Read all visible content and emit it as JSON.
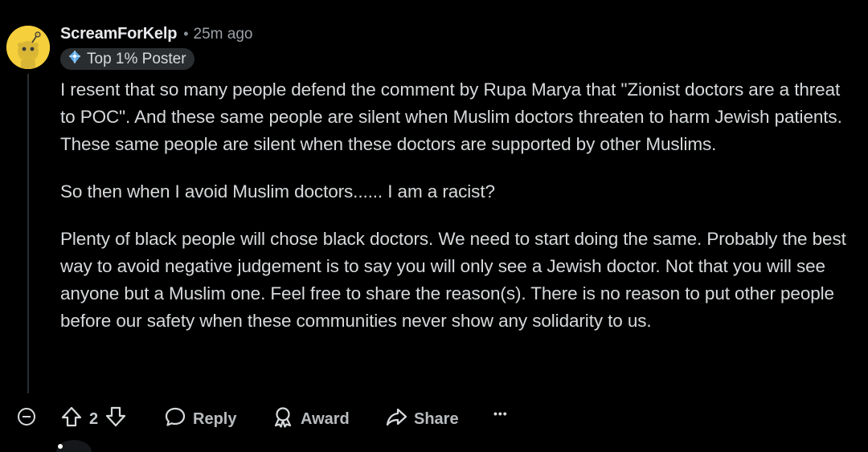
{
  "comment": {
    "author": "ScreamForKelp",
    "separator": "•",
    "time": "25m ago",
    "flair": "Top 1% Poster",
    "avatar_color": "#f5cf3c",
    "paragraphs": [
      "I resent that so many people defend the comment by Rupa Marya that \"Zionist doctors are a threat to POC\". And these same people are silent when Muslim doctors threaten to harm Jewish patients. These same people are silent when these doctors are supported by other Muslims.",
      "So then when I avoid Muslim doctors...... I am a racist?",
      "Plenty of black people will chose black doctors. We need to start doing the same. Probably the best way to avoid negative judgement is to say you will only see a Jewish doctor. Not that you will see anyone but a Muslim one. Feel free to share the reason(s). There is no reason to put other people before our safety when these communities never show any solidarity to us."
    ]
  },
  "actions": {
    "vote_count": "2",
    "reply_label": "Reply",
    "award_label": "Award",
    "share_label": "Share",
    "more_label": "•••"
  },
  "icons": {
    "collapse": "collapse-icon",
    "upvote": "upvote-icon",
    "downvote": "downvote-icon",
    "reply": "reply-icon",
    "award": "award-icon",
    "share": "share-icon",
    "more": "more-icon",
    "flair": "diamond-badge-icon"
  }
}
